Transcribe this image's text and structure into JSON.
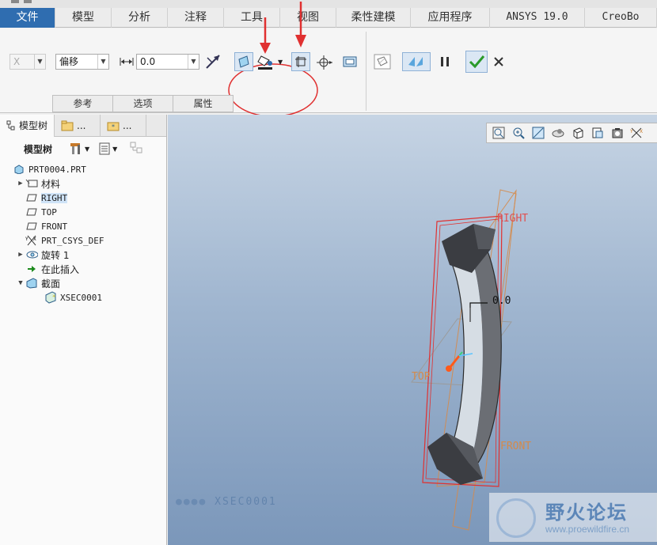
{
  "tabs": [
    {
      "label": "文件",
      "active": true
    },
    {
      "label": "模型"
    },
    {
      "label": "分析"
    },
    {
      "label": "注释"
    },
    {
      "label": "工具"
    },
    {
      "label": "视图"
    },
    {
      "label": "柔性建模"
    },
    {
      "label": "应用程序"
    },
    {
      "label": "ANSYS 19.0"
    },
    {
      "label": "CreoBo"
    }
  ],
  "ribbon": {
    "axis_select": "X",
    "offset_type": "偏移",
    "offset_value": "0.0",
    "slots": [
      "参考",
      "选项",
      "属性"
    ]
  },
  "left_panel": {
    "tab_model_tree": "模型树",
    "tab_folder": "...",
    "tab_favorites": "...",
    "toolbar_label": "模型树",
    "tree": [
      {
        "label": "PRT0004.PRT",
        "icon": "part-icon"
      },
      {
        "label": "材料",
        "icon": "material-icon",
        "expand": "▶"
      },
      {
        "label": "RIGHT",
        "icon": "datum-plane-icon",
        "highlight": true
      },
      {
        "label": "TOP",
        "icon": "datum-plane-icon"
      },
      {
        "label": "FRONT",
        "icon": "datum-plane-icon"
      },
      {
        "label": "PRT_CSYS_DEF",
        "icon": "csys-icon"
      },
      {
        "label": "旋转 1",
        "icon": "revolve-icon",
        "expand": "▶"
      },
      {
        "label": "在此插入",
        "icon": "insert-arrow-icon"
      },
      {
        "label": "截面",
        "icon": "section-icon",
        "expand": "▼"
      },
      {
        "label": "XSEC0001",
        "icon": "xsection-icon"
      }
    ]
  },
  "viewport": {
    "labels": {
      "right": "RIGHT",
      "top": "TOP",
      "front": "FRONT",
      "dimension": "0.0",
      "section_name": "XSEC0001"
    },
    "watermark": {
      "title": "野火论坛",
      "url": "www.proewildfire.cn"
    }
  },
  "colors": {
    "active_tab": "#2f6db0",
    "confirm": "#2a9a2a",
    "annotation_red": "#e03030",
    "datum_orange": "#d58a4a"
  }
}
